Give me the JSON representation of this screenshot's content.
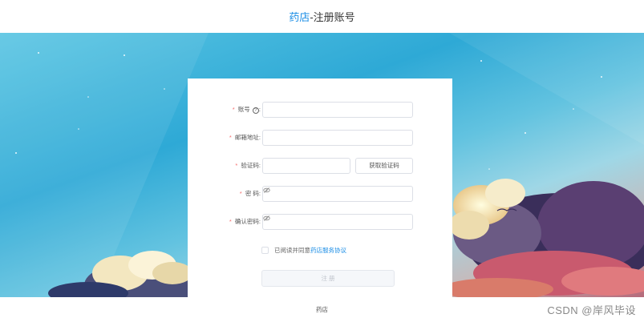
{
  "header": {
    "brand": "药店",
    "title": "-注册账号"
  },
  "form": {
    "account": {
      "label": "账号",
      "value": ""
    },
    "email": {
      "label": "邮箱地址",
      "value": ""
    },
    "code": {
      "label": "验证码",
      "value": "",
      "button": "获取验证码"
    },
    "password": {
      "label": "密 码",
      "value": ""
    },
    "confirm": {
      "label": "确认密码",
      "value": ""
    },
    "agree_text": "已阅读并同意",
    "agree_link": "药店服务协议",
    "submit": "注 册"
  },
  "footer": {
    "text": "药店"
  },
  "watermark": "CSDN @岸风毕设"
}
